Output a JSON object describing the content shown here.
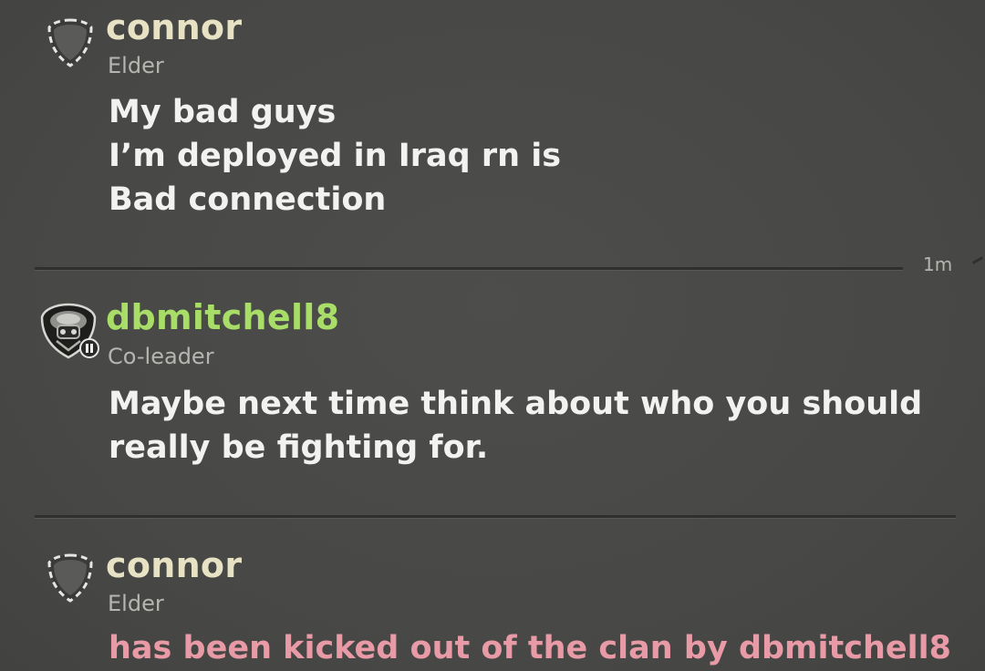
{
  "colors": {
    "background": "#4a4a48",
    "elder_name": "#e8e2c4",
    "coleader_name": "#a8dd68",
    "role_text": "#b5b5b2",
    "message_text": "#f2f2f0",
    "system_text": "#e89aa6"
  },
  "messages": [
    {
      "avatar_icon": "empty-shield-icon",
      "name": "connor",
      "role": "Elder",
      "lines": [
        "My bad guys",
        "I’m deployed in Iraq rn is",
        "Bad connection"
      ],
      "timestamp": "1m"
    },
    {
      "avatar_icon": "helmet-emblem-icon",
      "name": "dbmitchell8",
      "role": "Co-leader",
      "lines": [
        "Maybe next time think about who you should",
        "really be fighting for."
      ]
    },
    {
      "avatar_icon": "empty-shield-icon",
      "name": "connor",
      "role": "Elder",
      "system_line": "has been kicked out of the clan by dbmitchell8"
    }
  ]
}
